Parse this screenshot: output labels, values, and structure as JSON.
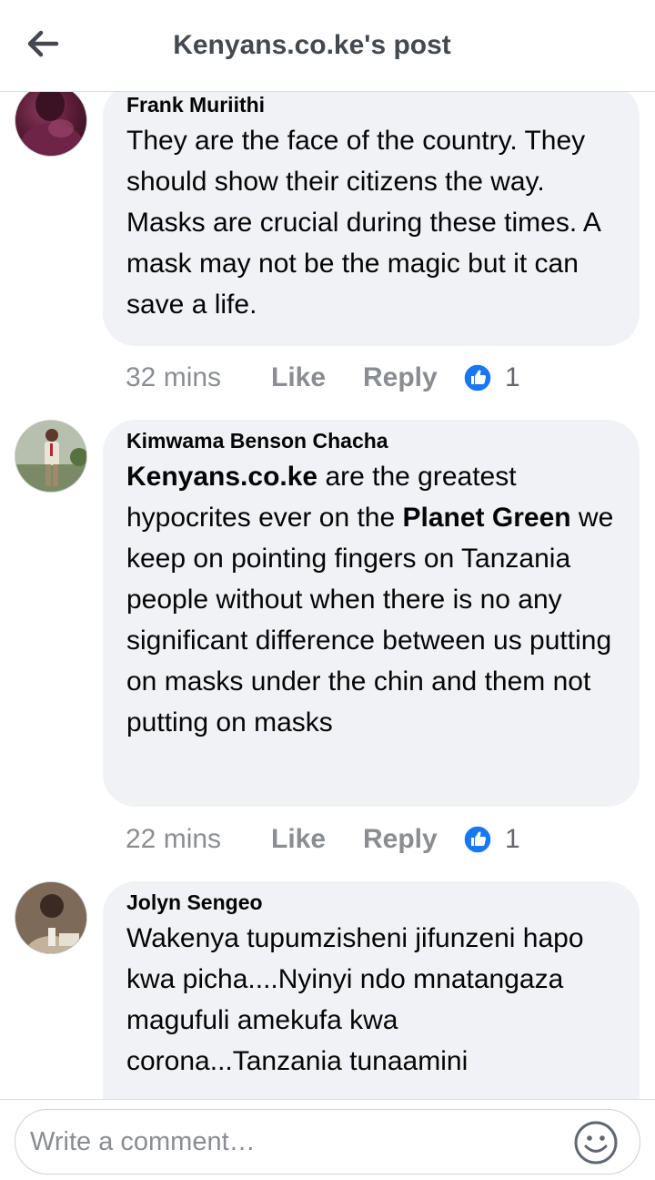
{
  "header": {
    "title": "Kenyans.co.ke's post",
    "back_icon": "arrow-left-icon"
  },
  "comments": [
    {
      "author": "Frank Muriithi",
      "text": "They are the face of the country. They should show their citizens the way. Masks are crucial during these times. A mask may not be the magic but it can save a life.",
      "time": "32 mins",
      "like_label": "Like",
      "reply_label": "Reply",
      "reaction_icon": "thumbs-up-icon",
      "reaction_count": "1"
    },
    {
      "author": "Kimwama Benson Chacha",
      "text_parts": {
        "mention1": "Kenyans.co.ke",
        "mid": " are the greatest hypocrites ever on the ",
        "mention2": "Planet Green",
        "end": " we keep on pointing fingers on Tanzania people without when there is no any significant difference between us putting on masks under the chin and them not putting on masks"
      },
      "time": "22 mins",
      "like_label": "Like",
      "reply_label": "Reply",
      "reaction_icon": "thumbs-up-icon",
      "reaction_count": "1"
    },
    {
      "author": "Jolyn Sengeo",
      "text": "Wakenya tupumzisheni jifunzeni hapo kwa picha....Nyinyi ndo mnatangaza magufuli amekufa kwa corona...Tanzania tunaamini"
    }
  ],
  "composer": {
    "placeholder": "Write a comment…",
    "emoji_icon": "smiley-icon"
  },
  "colors": {
    "bubble": "#f0f2f5",
    "meta_text": "#8a8d91",
    "like_blue": "#1877f2",
    "header_title": "#444950"
  }
}
